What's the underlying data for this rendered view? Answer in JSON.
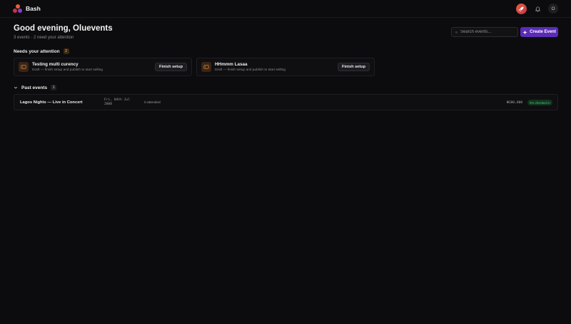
{
  "app": {
    "name": "Bash"
  },
  "header": {
    "avatar_initial": "O"
  },
  "greeting": {
    "title": "Good evening, Oluevents",
    "subtitle": "3 events · 2 need your attention"
  },
  "search": {
    "placeholder": "Search events..."
  },
  "create_button": {
    "label": "Create Event"
  },
  "attention": {
    "title": "Needs your attention",
    "count": "2",
    "items": [
      {
        "title": "Testing multi curency",
        "subtitle": "Draft — finish setup and publish to start selling",
        "action": "Finish setup"
      },
      {
        "title": "HHmmm Lasaa",
        "subtitle": "Draft — finish setup and publish to start selling",
        "action": "Finish setup"
      }
    ]
  },
  "past": {
    "title": "Past events",
    "count": "1",
    "events": [
      {
        "name": "Lagos Nights — Live in Concert",
        "date": "Fri, 04th Jul 2008",
        "attended": "0 attended",
        "price": "₦100,000",
        "checked_in": "0% checked in"
      }
    ]
  },
  "colors": {
    "background": "#0c0c0e",
    "accent": "#5b2bb8",
    "badge_orange": "#e0892f",
    "success": "#4cc47a"
  }
}
